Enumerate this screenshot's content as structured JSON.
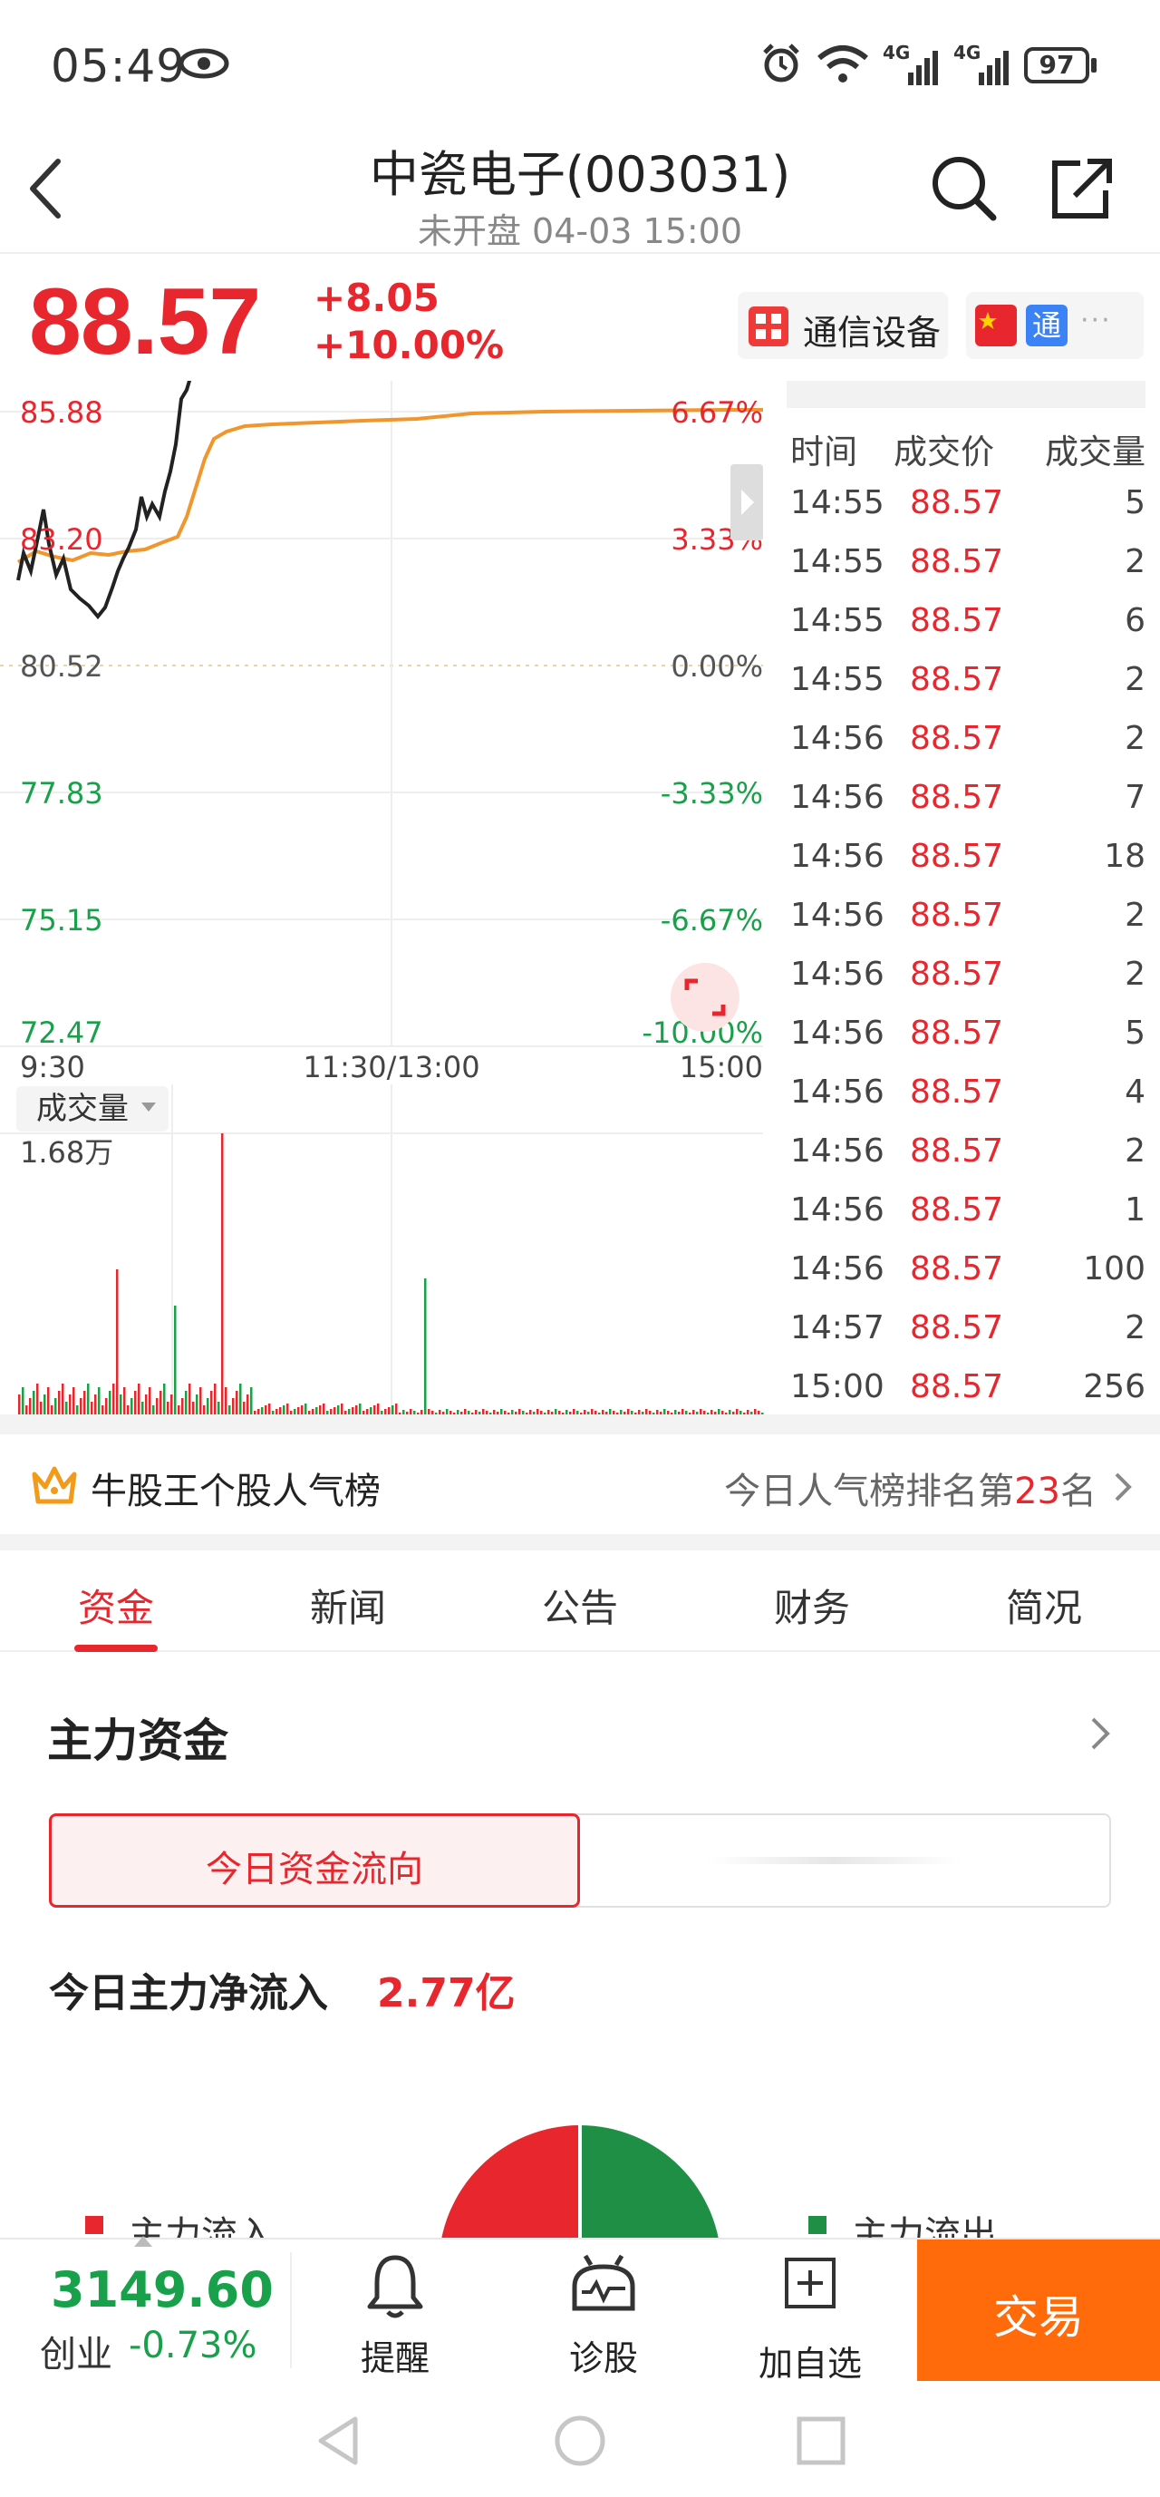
{
  "status_bar": {
    "time": "05:49",
    "battery": "97",
    "network_1": "4G",
    "network_2": "4G"
  },
  "header": {
    "title": "中瓷电子(003031)",
    "subtitle": "未开盘 04-03 15:00"
  },
  "quote": {
    "price": "88.57",
    "change_abs": "+8.05",
    "change_pct": "+10.00%",
    "industry": "通信设备",
    "tag_tong": "通"
  },
  "chart": {
    "left_axis": [
      "85.88",
      "83.20",
      "80.52",
      "77.83",
      "75.15",
      "72.47"
    ],
    "right_axis": [
      "6.67%",
      "3.33%",
      "0.00%",
      "-3.33%",
      "-6.67%",
      "-10.00%"
    ],
    "time_axis": [
      "9:30",
      "11:30/13:00",
      "15:00"
    ],
    "volume_label": "成交量",
    "volume_max": "1.68万"
  },
  "trades": {
    "headers": [
      "时间",
      "成交价",
      "成交量"
    ],
    "rows": [
      {
        "time": "14:55",
        "price": "88.57",
        "vol": "5"
      },
      {
        "time": "14:55",
        "price": "88.57",
        "vol": "2"
      },
      {
        "time": "14:55",
        "price": "88.57",
        "vol": "6"
      },
      {
        "time": "14:55",
        "price": "88.57",
        "vol": "2"
      },
      {
        "time": "14:56",
        "price": "88.57",
        "vol": "2"
      },
      {
        "time": "14:56",
        "price": "88.57",
        "vol": "7"
      },
      {
        "time": "14:56",
        "price": "88.57",
        "vol": "18"
      },
      {
        "time": "14:56",
        "price": "88.57",
        "vol": "2"
      },
      {
        "time": "14:56",
        "price": "88.57",
        "vol": "2"
      },
      {
        "time": "14:56",
        "price": "88.57",
        "vol": "5"
      },
      {
        "time": "14:56",
        "price": "88.57",
        "vol": "4"
      },
      {
        "time": "14:56",
        "price": "88.57",
        "vol": "2"
      },
      {
        "time": "14:56",
        "price": "88.57",
        "vol": "1"
      },
      {
        "time": "14:56",
        "price": "88.57",
        "vol": "100"
      },
      {
        "time": "14:57",
        "price": "88.57",
        "vol": "2"
      },
      {
        "time": "15:00",
        "price": "88.57",
        "vol": "256"
      }
    ]
  },
  "ranking": {
    "title": "牛股王个股人气榜",
    "prefix": "今日人气榜排名第",
    "rank": "23",
    "suffix": "名"
  },
  "tabs": [
    "资金",
    "新闻",
    "公告",
    "财务",
    "简况"
  ],
  "fund": {
    "title": "主力资金",
    "toggle_left": "今日资金流向",
    "net_label": "今日主力净流入",
    "net_value": "2.77亿",
    "legend_in": "主力流入",
    "legend_out": "主力流出"
  },
  "bottom": {
    "index_value": "3149.60",
    "index_name": "创业",
    "index_change": "-0.73%",
    "remind": "提醒",
    "diagnose": "诊股",
    "add_watch": "加自选",
    "trade": "交易"
  },
  "colors": {
    "up": "#e8262e",
    "down": "#18a14a",
    "avg_line": "#f0962c",
    "trade_button": "#ff6a0a"
  }
}
